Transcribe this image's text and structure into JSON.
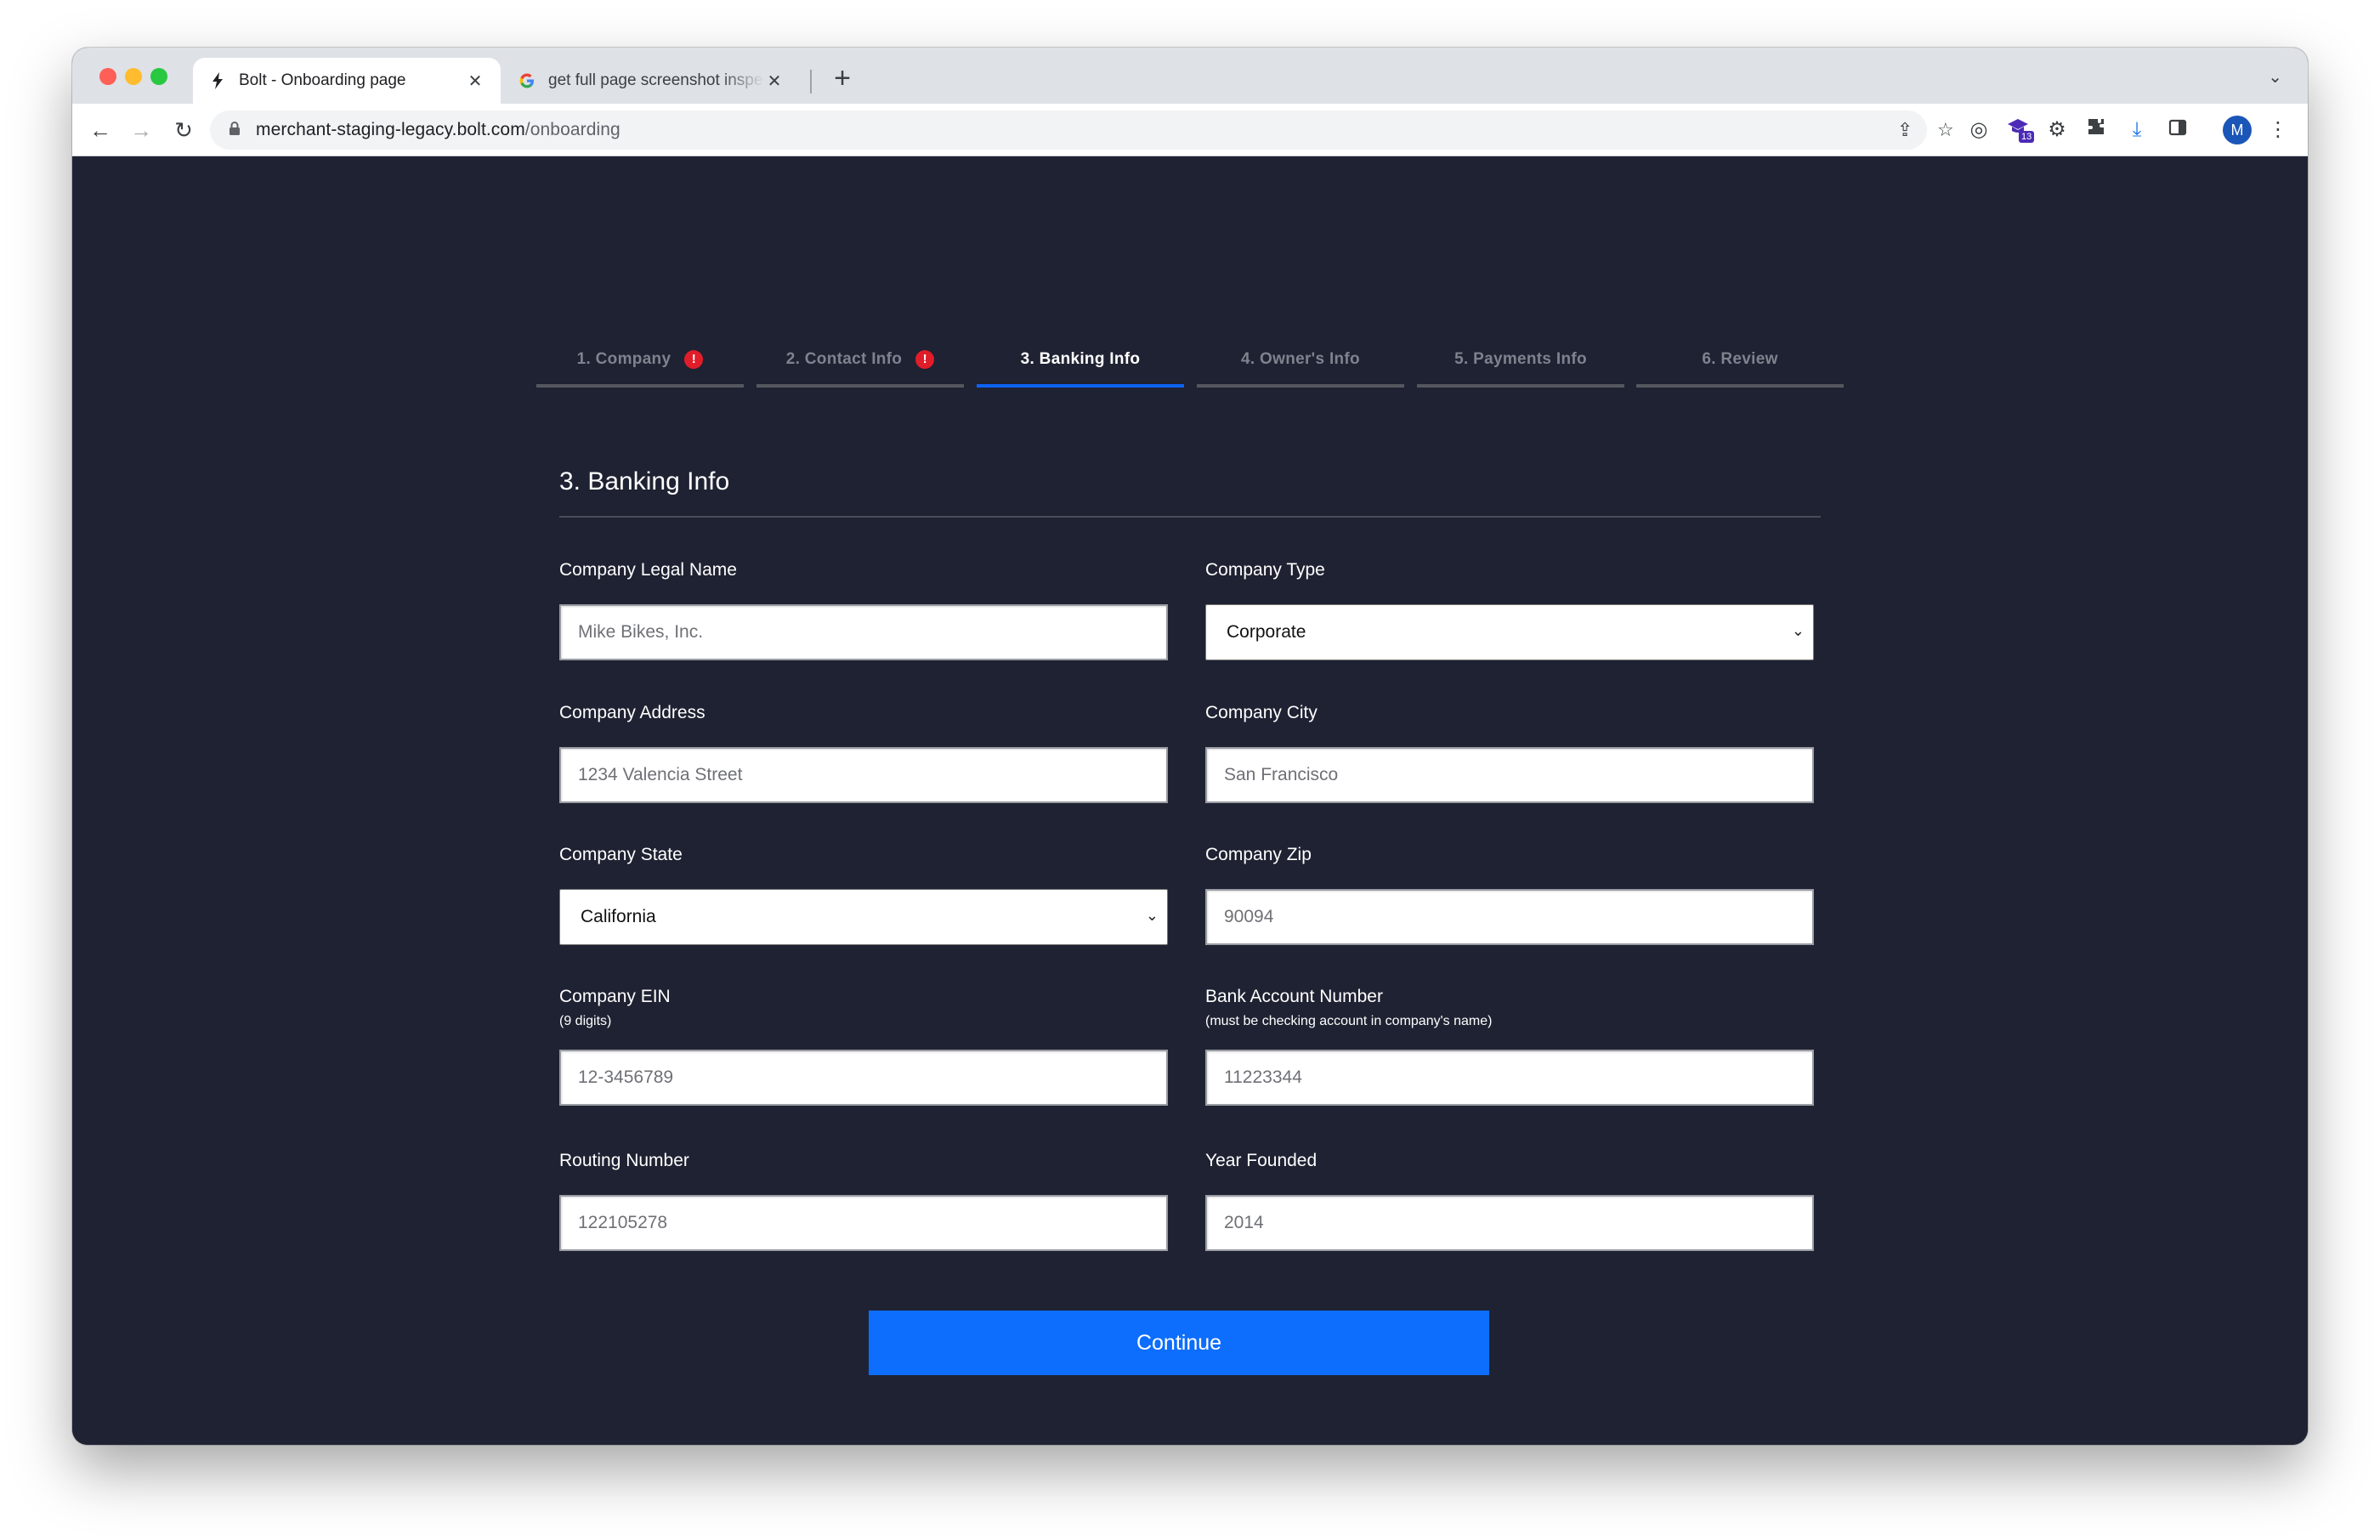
{
  "browser": {
    "tabs": [
      {
        "title": "Bolt - Onboarding page",
        "favicon": "bolt-icon",
        "active": true
      },
      {
        "title": "get full page screenshot inspect",
        "favicon": "google-icon",
        "active": false
      }
    ],
    "url_host": "merchant-staging-legacy.bolt.com",
    "url_path": "/onboarding",
    "extension_badge": "13",
    "profile_initial": "M"
  },
  "stepper": {
    "steps": [
      {
        "label": "1. Company",
        "alert": "!",
        "state": "error"
      },
      {
        "label": "2. Contact Info",
        "alert": "!",
        "state": "error"
      },
      {
        "label": "3. Banking Info",
        "state": "active"
      },
      {
        "label": "4. Owner's Info",
        "state": "inactive"
      },
      {
        "label": "5. Payments Info",
        "state": "inactive"
      },
      {
        "label": "6. Review",
        "state": "inactive"
      }
    ]
  },
  "form": {
    "title": "3. Banking Info",
    "fields": {
      "legal_name": {
        "label": "Company Legal Name",
        "placeholder": "Mike Bikes, Inc."
      },
      "company_type": {
        "label": "Company Type",
        "value": "Corporate"
      },
      "address": {
        "label": "Company Address",
        "placeholder": "1234 Valencia Street"
      },
      "city": {
        "label": "Company City",
        "placeholder": "San Francisco"
      },
      "state": {
        "label": "Company State",
        "value": "California"
      },
      "zip": {
        "label": "Company Zip",
        "placeholder": "90094"
      },
      "ein": {
        "label": "Company EIN",
        "hint": "(9 digits)",
        "placeholder": "12-3456789"
      },
      "bank_account": {
        "label": "Bank Account Number",
        "hint": "(must be checking account in company's name)",
        "placeholder": "11223344"
      },
      "routing": {
        "label": "Routing Number",
        "placeholder": "122105278"
      },
      "year_founded": {
        "label": "Year Founded",
        "placeholder": "2014"
      }
    },
    "continue_label": "Continue"
  },
  "colors": {
    "page_bg": "#1f2232",
    "accent": "#0d6efd",
    "active_step_underline": "#0d63f3",
    "alert": "#e11d2a"
  }
}
